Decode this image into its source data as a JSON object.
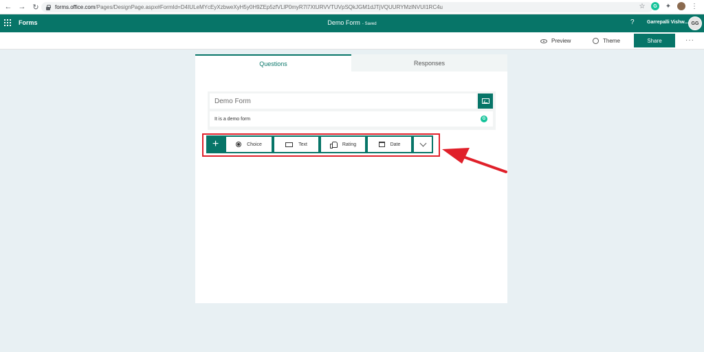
{
  "browser": {
    "url_host": "forms.office.com",
    "url_path": "/Pages/DesignPage.aspx#FormId=D4IULeMYcEyXzbweXyH5y0H9ZEp5zfVLlP0myR7l7XtURVVTUVpSQkJGM1dJTjVQUURYMzlNVUI1RC4u"
  },
  "appbar": {
    "app_name": "Forms",
    "form_title": "Demo Form",
    "saved_label": "- Saved",
    "help_label": "?",
    "user_name": "Garrepalli Vishw...",
    "user_initials": "GG"
  },
  "toolbar": {
    "preview_label": "Preview",
    "theme_label": "Theme",
    "share_label": "Share",
    "more_label": "···"
  },
  "tabs": [
    {
      "label": "Questions",
      "active": true
    },
    {
      "label": "Responses",
      "active": false
    }
  ],
  "form": {
    "title": "Demo Form",
    "description": "It is a demo form"
  },
  "add_question": {
    "plus_label": "+",
    "types": [
      {
        "label": "Choice",
        "icon": "radio-icon"
      },
      {
        "label": "Text",
        "icon": "text-icon"
      },
      {
        "label": "Rating",
        "icon": "thumbs-up-icon"
      },
      {
        "label": "Date",
        "icon": "calendar-icon"
      }
    ]
  },
  "annotation": {
    "highlight_color": "#e0202a"
  },
  "colors": {
    "brand": "#077568",
    "page_bg": "#e8f0f3"
  }
}
